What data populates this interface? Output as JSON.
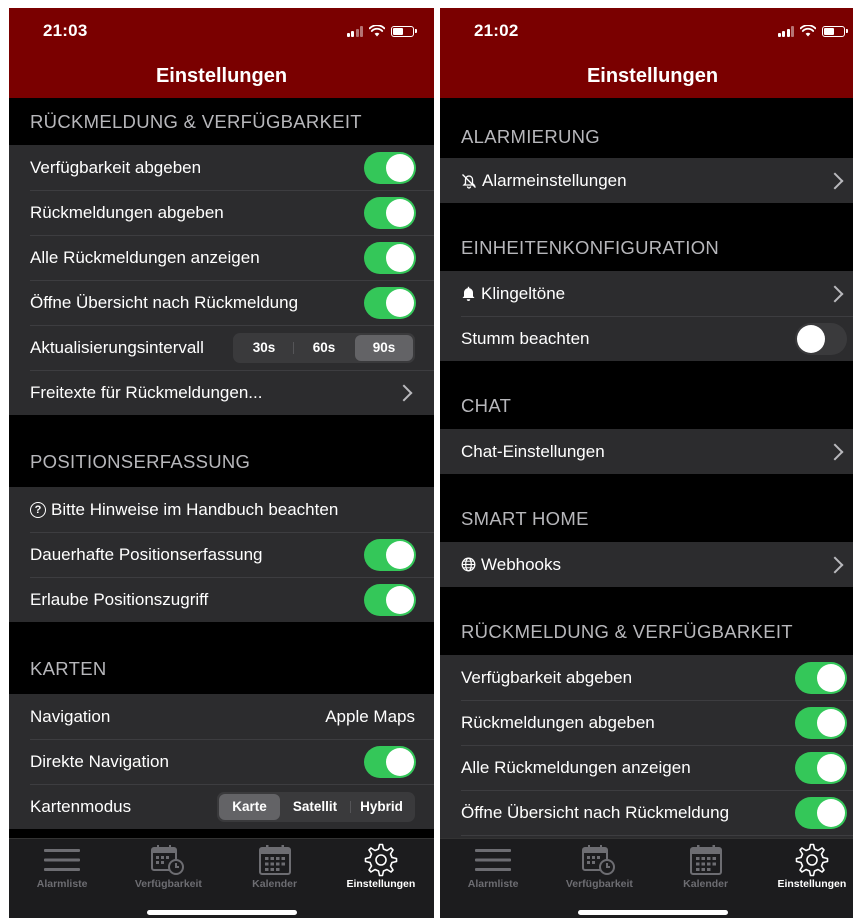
{
  "left": {
    "status": {
      "time": "21:03"
    },
    "nav_title": "Einstellungen",
    "sections": {
      "rueckmeldung": {
        "header": "RÜCKMELDUNG & VERFÜGBARKEIT",
        "verfuegbarkeit": "Verfügbarkeit abgeben",
        "rueckmeldungen": "Rückmeldungen abgeben",
        "alle_anzeigen": "Alle Rückmeldungen anzeigen",
        "oeffne_uebersicht": "Öffne Übersicht nach Rückmeldung",
        "intervall": "Aktualisierungsintervall",
        "intervall_options": [
          "30s",
          "60s",
          "90s"
        ],
        "intervall_selected": "90s",
        "freitexte": "Freitexte für Rückmeldungen..."
      },
      "position": {
        "header": "POSITIONSERFASSUNG",
        "hinweis": "Bitte Hinweise im Handbuch beachten",
        "dauerhaft": "Dauerhafte Positionserfassung",
        "erlaube": "Erlaube Positionszugriff"
      },
      "karten": {
        "header": "KARTEN",
        "navigation": "Navigation",
        "navigation_value": "Apple Maps",
        "direkte": "Direkte Navigation",
        "kartenmodus": "Kartenmodus",
        "modus_options": [
          "Karte",
          "Satellit",
          "Hybrid"
        ],
        "modus_selected": "Karte"
      }
    }
  },
  "right": {
    "status": {
      "time": "21:02"
    },
    "nav_title": "Einstellungen",
    "sections": {
      "alarmierung": {
        "header": "ALARMIERUNG",
        "alarmeinstellungen": "Alarmeinstellungen"
      },
      "einheiten": {
        "header": "EINHEITENKONFIGURATION",
        "klingeltoene": "Klingeltöne",
        "stumm": "Stumm beachten"
      },
      "chat": {
        "header": "CHAT",
        "einstellungen": "Chat-Einstellungen"
      },
      "smarthome": {
        "header": "SMART HOME",
        "webhooks": "Webhooks"
      },
      "rueckmeldung": {
        "header": "RÜCKMELDUNG & VERFÜGBARKEIT",
        "verfuegbarkeit": "Verfügbarkeit abgeben",
        "rueckmeldungen": "Rückmeldungen abgeben",
        "alle_anzeigen": "Alle Rückmeldungen anzeigen",
        "oeffne_uebersicht": "Öffne Übersicht nach Rückmeldung"
      }
    }
  },
  "tabbar": {
    "alarmliste": "Alarmliste",
    "verfuegbarkeit": "Verfügbarkeit",
    "kalender": "Kalender",
    "einstellungen": "Einstellungen",
    "active": "Einstellungen"
  },
  "colors": {
    "header_red": "#7a0000",
    "toggle_green": "#34c759",
    "cell_bg": "#2c2c2e",
    "section_text": "#b7b7bb"
  },
  "icons": {
    "help": "question-circle-icon",
    "alarm": "bell-slash-icon",
    "bell": "bell-icon",
    "globe": "globe-icon",
    "chevron": "chevron-right-icon",
    "tab_list": "list-icon",
    "tab_availability": "calendar-clock-icon",
    "tab_calendar": "calendar-icon",
    "tab_settings": "gear-icon"
  }
}
